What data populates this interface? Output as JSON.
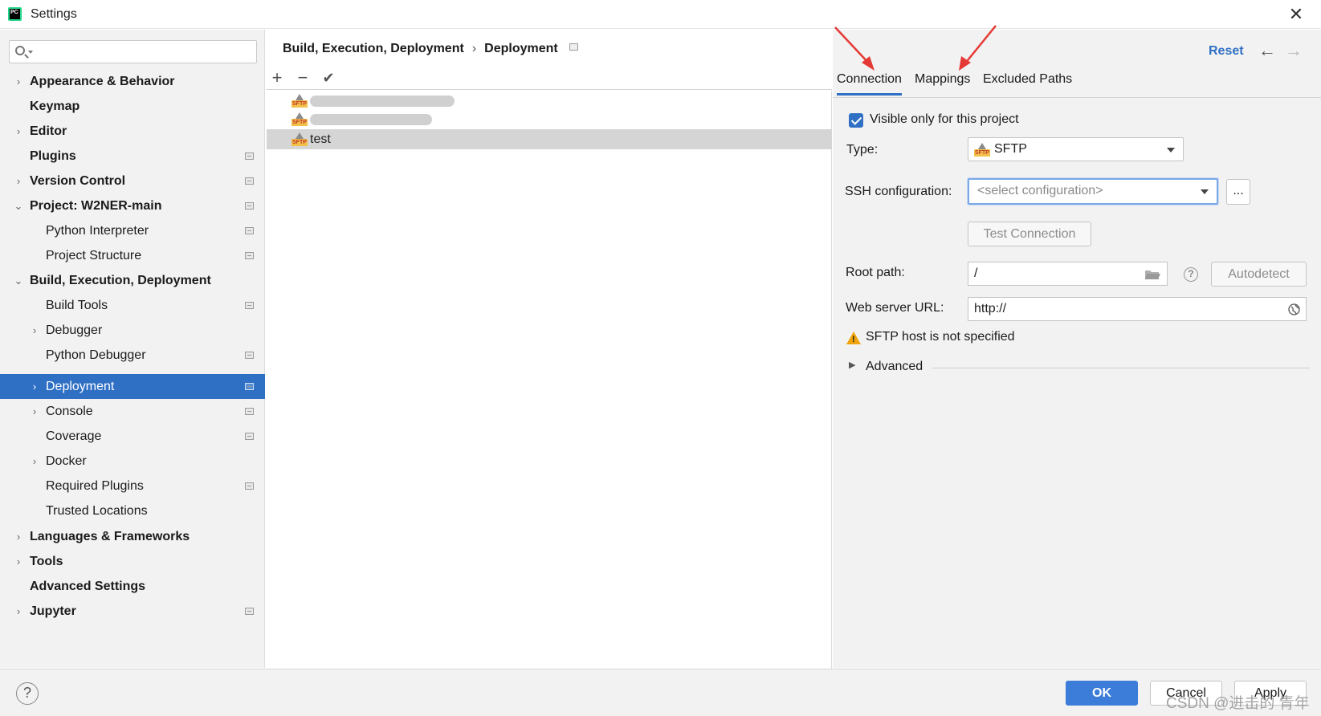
{
  "window": {
    "title": "Settings"
  },
  "search": {
    "placeholder": ""
  },
  "sidebar": {
    "items": [
      {
        "label": "Appearance & Behavior"
      },
      {
        "label": "Keymap"
      },
      {
        "label": "Editor"
      },
      {
        "label": "Plugins"
      },
      {
        "label": "Version Control"
      },
      {
        "label": "Project: W2NER-main"
      },
      {
        "label": "Python Interpreter"
      },
      {
        "label": "Project Structure"
      },
      {
        "label": "Build, Execution, Deployment"
      },
      {
        "label": "Build Tools"
      },
      {
        "label": "Debugger"
      },
      {
        "label": "Python Debugger"
      },
      {
        "label": "Deployment"
      },
      {
        "label": "Console"
      },
      {
        "label": "Coverage"
      },
      {
        "label": "Docker"
      },
      {
        "label": "Required Plugins"
      },
      {
        "label": "Trusted Locations"
      },
      {
        "label": "Languages & Frameworks"
      },
      {
        "label": "Tools"
      },
      {
        "label": "Advanced Settings"
      },
      {
        "label": "Jupyter"
      }
    ]
  },
  "breadcrumb": {
    "parent": "Build, Execution, Deployment",
    "current": "Deployment",
    "separator": "›"
  },
  "header": {
    "reset_label": "Reset",
    "back_icon": "←",
    "forward_icon": "→"
  },
  "toolbar": {
    "add": "+",
    "remove": "−",
    "apply": "✔"
  },
  "servers": {
    "items": [
      {
        "name": ""
      },
      {
        "name": ""
      },
      {
        "name": "test"
      }
    ],
    "icon_tag": "SFTP"
  },
  "tabs": {
    "connection": "Connection",
    "mappings": "Mappings",
    "excluded": "Excluded Paths"
  },
  "connection": {
    "visible_only_label": "Visible only for this project",
    "type_label": "Type:",
    "type_value": "SFTP",
    "ssh_label": "SSH configuration:",
    "ssh_placeholder": "<select configuration>",
    "ssh_more": "...",
    "test_connection": "Test Connection",
    "root_label": "Root path:",
    "root_value": "/",
    "autodetect": "Autodetect",
    "web_label": "Web server URL:",
    "web_value": "http://",
    "warning": "SFTP host is not specified",
    "advanced": "Advanced"
  },
  "footer": {
    "ok": "OK",
    "cancel": "Cancel",
    "apply": "Apply",
    "help": "?"
  },
  "watermark": "CSDN @进击的 青年",
  "colors": {
    "accent": "#2f70c4",
    "selection_gray": "#d5d5d5",
    "warning": "#f0a30a",
    "annotation_red": "#e53935"
  }
}
